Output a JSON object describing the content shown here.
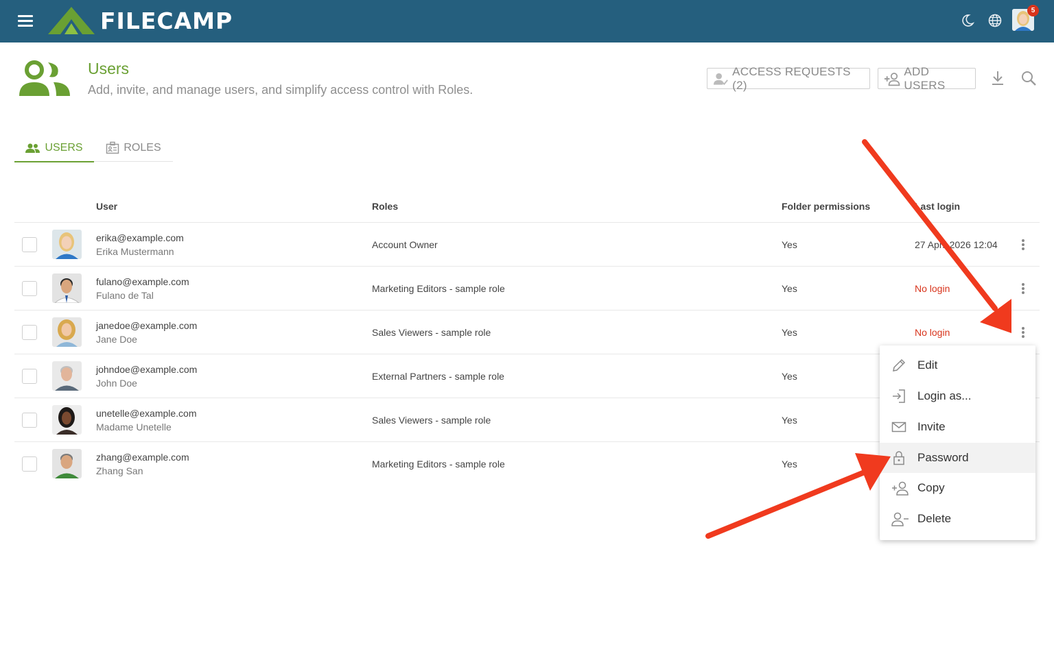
{
  "topbar": {
    "brand": "FILECAMP",
    "notifications_count": "5",
    "bg_color": "#255f7e"
  },
  "header": {
    "title": "Users",
    "subtitle": "Add, invite, and manage users, and simplify access control with Roles.",
    "access_requests_label": "ACCESS REQUESTS (2)",
    "add_users_label": "ADD USERS"
  },
  "tabs": [
    {
      "label": "USERS",
      "active": true
    },
    {
      "label": "ROLES",
      "active": false
    }
  ],
  "table": {
    "columns": [
      "User",
      "Roles",
      "Folder permissions",
      "Last login"
    ],
    "rows": [
      {
        "email": "erika@example.com",
        "name": "Erika Mustermann",
        "role": "Account Owner",
        "permissions": "Yes",
        "last_login": "27 April 2026 12:04"
      },
      {
        "email": "fulano@example.com",
        "name": "Fulano de Tal",
        "role": "Marketing Editors - sample role",
        "permissions": "Yes",
        "last_login": "No login"
      },
      {
        "email": "janedoe@example.com",
        "name": "Jane Doe",
        "role": "Sales Viewers - sample role",
        "permissions": "Yes",
        "last_login": "No login"
      },
      {
        "email": "johndoe@example.com",
        "name": "John Doe",
        "role": "External Partners - sample role",
        "permissions": "Yes",
        "last_login": ""
      },
      {
        "email": "unetelle@example.com",
        "name": "Madame Unetelle",
        "role": "Sales Viewers - sample role",
        "permissions": "Yes",
        "last_login": ""
      },
      {
        "email": "zhang@example.com",
        "name": "Zhang San",
        "role": "Marketing Editors - sample role",
        "permissions": "Yes",
        "last_login": ""
      }
    ]
  },
  "context_menu": {
    "items": [
      {
        "label": "Edit",
        "icon": "pencil-icon"
      },
      {
        "label": "Login as...",
        "icon": "login-icon"
      },
      {
        "label": "Invite",
        "icon": "mail-icon"
      },
      {
        "label": "Password",
        "icon": "lock-icon",
        "highlighted": true
      },
      {
        "label": "Copy",
        "icon": "copy-user-icon"
      },
      {
        "label": "Delete",
        "icon": "remove-user-icon"
      }
    ]
  },
  "colors": {
    "accent_green": "#6aa033",
    "error_red": "#d8341c",
    "annotation_arrow": "#f03a1e"
  }
}
